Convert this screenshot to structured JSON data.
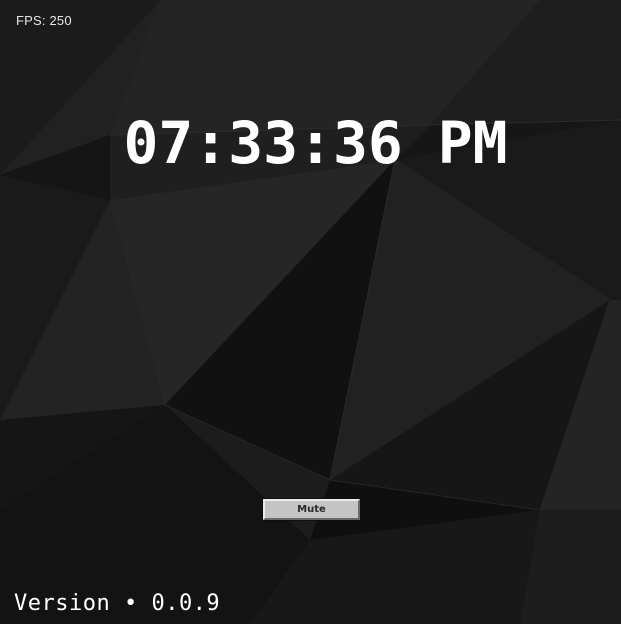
{
  "hud": {
    "fps_text": "FPS: 250"
  },
  "clock": {
    "time": "07:33:36 PM"
  },
  "controls": {
    "mute_label": "Mute"
  },
  "footer": {
    "version_text": "Version • 0.0.9"
  },
  "colors": {
    "background": "#161616",
    "text": "#ffffff",
    "button_face": "#c4c4c4"
  }
}
